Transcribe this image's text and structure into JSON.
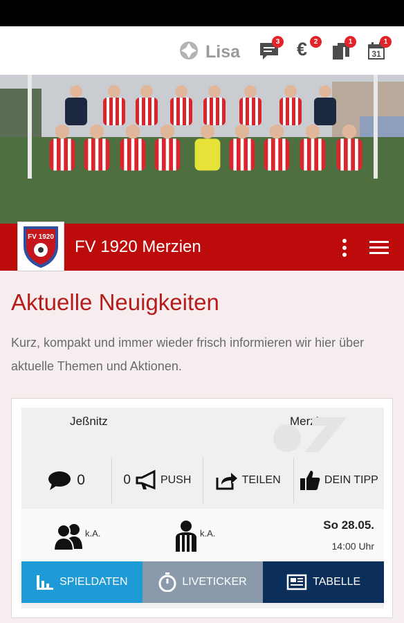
{
  "topbar": {
    "brand_name": "Lisa",
    "icons": [
      {
        "name": "chat-icon",
        "badge": "3"
      },
      {
        "name": "euro-icon",
        "symbol": "€",
        "badge": "2"
      },
      {
        "name": "documents-icon",
        "badge": "1"
      },
      {
        "name": "calendar-icon",
        "day": "31",
        "badge": "1"
      }
    ]
  },
  "club": {
    "name": "FV 1920 Merzien",
    "crest_text": "FV 1920"
  },
  "news": {
    "title": "Aktuelle Neuigkeiten",
    "text": "Kurz, kompakt und immer wieder frisch informieren wir hier über aktuelle Themen und Aktionen."
  },
  "match": {
    "home_team": "Jeßnitz",
    "away_team": "Merzien",
    "comments_count": "0",
    "push_count": "0",
    "push_label": "PUSH",
    "share_label": "TEILEN",
    "tip_label": "DEIN TIPP",
    "spectators": "k.A.",
    "referee": "k.A.",
    "date": "So 28.05.",
    "time": "14:00 Uhr"
  },
  "tabs": [
    {
      "label": "SPIELDATEN",
      "color": "#1e9ad6"
    },
    {
      "label": "LIVETICKER",
      "color": "#8b9aab"
    },
    {
      "label": "TABELLE",
      "color": "#0b2f5a"
    }
  ],
  "colors": {
    "club_red": "#bd0a0a",
    "badge_red": "#e3232a",
    "title_red": "#b71c1c"
  }
}
